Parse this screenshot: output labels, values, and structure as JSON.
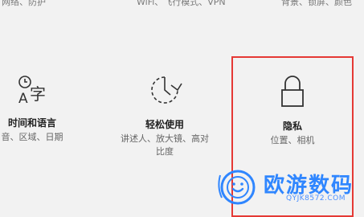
{
  "top_row": {
    "left": "网络、防护",
    "middle": "WiFi、飞行模式、VPN",
    "right": "背景、锁屏、颜色"
  },
  "tiles": [
    {
      "icon": "time-language-icon",
      "title": "时间和语言",
      "desc_line1": "音、区域、日期",
      "desc_line2": ""
    },
    {
      "icon": "ease-of-access-icon",
      "title": "轻松使用",
      "desc_line1": "讲述人、放大镜、高对",
      "desc_line2": "比度"
    },
    {
      "icon": "lock-icon",
      "title": "隐私",
      "desc_line1": "位置、相机",
      "desc_line2": ""
    }
  ],
  "watermark": {
    "brand": "欧游数码",
    "url": "QYJK8572.COM"
  },
  "colors": {
    "background": "#f2f2f2",
    "highlight_border": "#e53935",
    "watermark_blue": "#2f86ff"
  }
}
